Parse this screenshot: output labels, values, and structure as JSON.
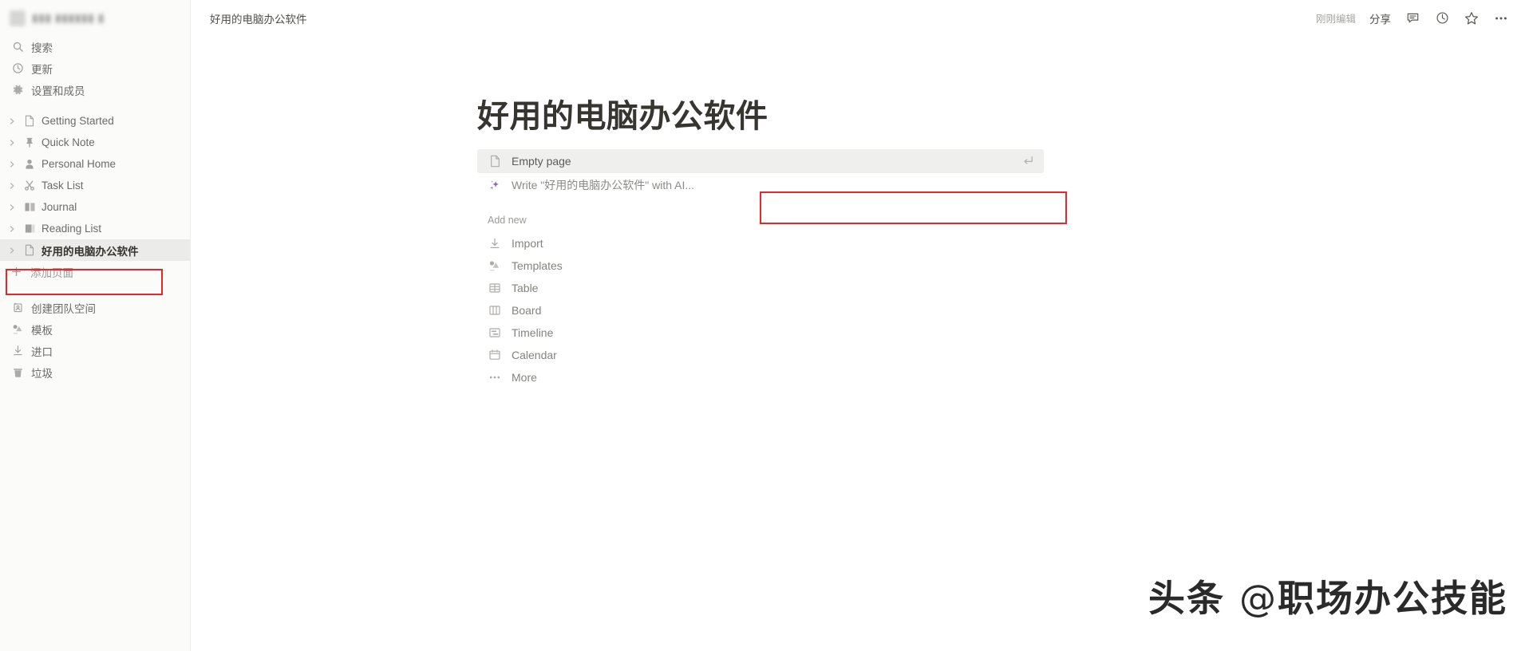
{
  "workspace": {
    "name_redacted": "",
    "avatar_redacted": ""
  },
  "sidebar": {
    "nav": [
      {
        "label": "搜索",
        "icon": "search-icon"
      },
      {
        "label": "更新",
        "icon": "clock-update-icon"
      },
      {
        "label": "设置和成员",
        "icon": "gear-icon"
      }
    ],
    "pages": [
      {
        "label": "Getting Started",
        "icon": "document-icon",
        "selected": false
      },
      {
        "label": "Quick Note",
        "icon": "pin-icon",
        "selected": false
      },
      {
        "label": "Personal Home",
        "icon": "person-icon",
        "selected": false
      },
      {
        "label": "Task List",
        "icon": "scissors-icon",
        "selected": false
      },
      {
        "label": "Journal",
        "icon": "open-book-icon",
        "selected": false
      },
      {
        "label": "Reading List",
        "icon": "books-icon",
        "selected": false
      },
      {
        "label": "好用的电脑办公软件",
        "icon": "document-icon",
        "selected": true
      }
    ],
    "add_page": {
      "label": "添加页面",
      "icon": "plus-icon"
    },
    "bottom": [
      {
        "label": "创建团队空间",
        "icon": "teamspace-icon"
      },
      {
        "label": "模板",
        "icon": "templates-icon"
      },
      {
        "label": "进口",
        "icon": "import-icon"
      },
      {
        "label": "垃圾",
        "icon": "trash-icon"
      }
    ]
  },
  "topbar": {
    "breadcrumb": "好用的电脑办公软件",
    "last_edited": "刚刚编辑",
    "share_label": "分享",
    "icons": [
      "comment-icon",
      "history-clock-icon",
      "star-icon",
      "more-horizontal-icon"
    ]
  },
  "main": {
    "page_title": "好用的电脑办公软件",
    "primary_options": [
      {
        "label": "Empty page",
        "icon": "document-icon",
        "highlighted": true,
        "shortcut_icon": "enter-return-icon"
      },
      {
        "label": "Write \"好用的电脑办公软件\" with AI...",
        "icon": "ai-sparkle-icon",
        "highlighted": false,
        "annotated": true
      }
    ],
    "add_new_label": "Add new",
    "add_new_items": [
      {
        "label": "Import",
        "icon": "import-arrow-icon"
      },
      {
        "label": "Templates",
        "icon": "templates-shapes-icon"
      },
      {
        "label": "Table",
        "icon": "table-grid-icon"
      },
      {
        "label": "Board",
        "icon": "board-columns-icon"
      },
      {
        "label": "Timeline",
        "icon": "timeline-icon"
      },
      {
        "label": "Calendar",
        "icon": "calendar-icon"
      },
      {
        "label": "More",
        "icon": "more-horizontal-icon"
      }
    ]
  },
  "watermark": {
    "prefix": "头条",
    "at": "@",
    "handle": "职场办公技能"
  },
  "colors": {
    "annotation_red": "#e8262b",
    "sidebar_bg": "#fbfbfa",
    "selected_row": "#ebebea",
    "ai_purple": "#8a63c4",
    "text_primary": "#37352f",
    "text_muted": "#9b9a97"
  }
}
